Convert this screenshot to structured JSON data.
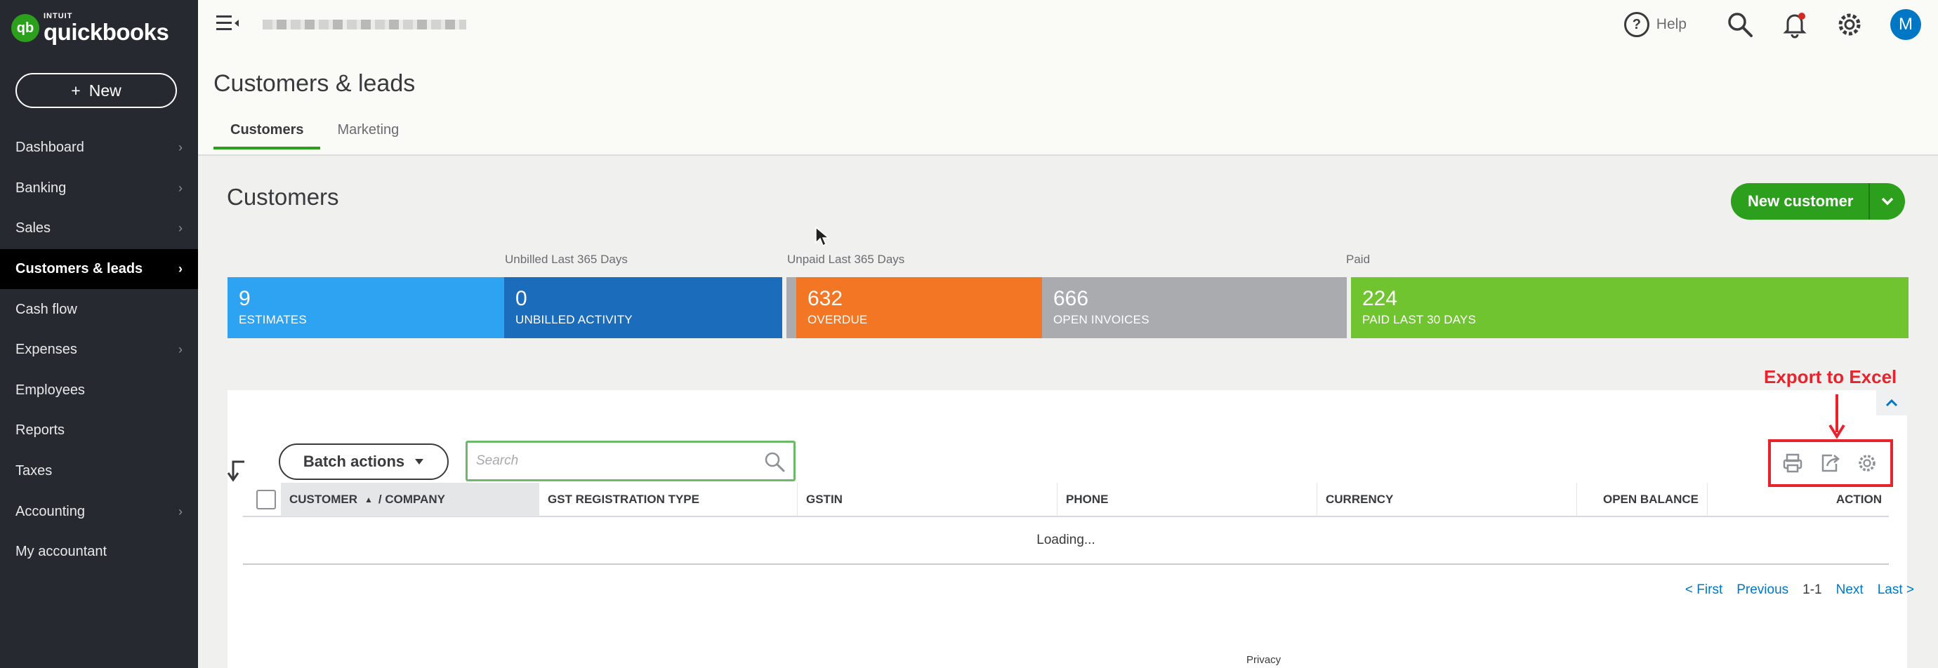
{
  "app": {
    "logo_small": "INTUIT",
    "logo_big": "quickbooks",
    "logo_badge": "qb"
  },
  "sidebar": {
    "new_label": "New",
    "items": [
      {
        "label": "Dashboard",
        "chevron": true
      },
      {
        "label": "Banking",
        "chevron": true
      },
      {
        "label": "Sales",
        "chevron": true
      },
      {
        "label": "Customers & leads",
        "chevron": true,
        "active": true
      },
      {
        "label": "Cash flow",
        "chevron": false
      },
      {
        "label": "Expenses",
        "chevron": true
      },
      {
        "label": "Employees",
        "chevron": false
      },
      {
        "label": "Reports",
        "chevron": false
      },
      {
        "label": "Taxes",
        "chevron": false
      },
      {
        "label": "Accounting",
        "chevron": true
      },
      {
        "label": "My accountant",
        "chevron": false
      }
    ]
  },
  "topbar": {
    "help_label": "Help",
    "avatar_initial": "M"
  },
  "header": {
    "title": "Customers & leads",
    "tabs": [
      {
        "label": "Customers",
        "active": true
      },
      {
        "label": "Marketing",
        "active": false
      }
    ]
  },
  "customers": {
    "title": "Customers",
    "new_customer_label": "New customer",
    "money_labels": {
      "unbilled": "Unbilled Last 365 Days",
      "unpaid": "Unpaid Last 365 Days",
      "paid": "Paid"
    },
    "segments": [
      {
        "value": "9",
        "label": "ESTIMATES",
        "color": "#2ea3f2"
      },
      {
        "value": "0",
        "label": "UNBILLED ACTIVITY",
        "color": "#1b6dbb"
      },
      {
        "value": "632",
        "label": "OVERDUE",
        "color": "#f37624"
      },
      {
        "value": "666",
        "label": "OPEN INVOICES",
        "color": "#a9abae"
      },
      {
        "value": "224",
        "label": "PAID LAST 30 DAYS",
        "color": "#6fc42f"
      }
    ],
    "batch_actions_label": "Batch actions",
    "search_placeholder": "Search",
    "export_annotation": "Export to Excel",
    "columns": [
      "CUSTOMER",
      "/ COMPANY",
      "GST REGISTRATION TYPE",
      "GSTIN",
      "PHONE",
      "CURRENCY",
      "OPEN BALANCE",
      "ACTION"
    ],
    "loading_text": "Loading...",
    "pager": {
      "first": "< First",
      "previous": "Previous",
      "range": "1-1",
      "next": "Next",
      "last": "Last >"
    },
    "privacy_label": "Privacy"
  },
  "colors": {
    "brand_green": "#2ca01c",
    "sidebar_bg": "#262a30",
    "link_blue": "#0077c5",
    "annotation_red": "#e8232e"
  }
}
